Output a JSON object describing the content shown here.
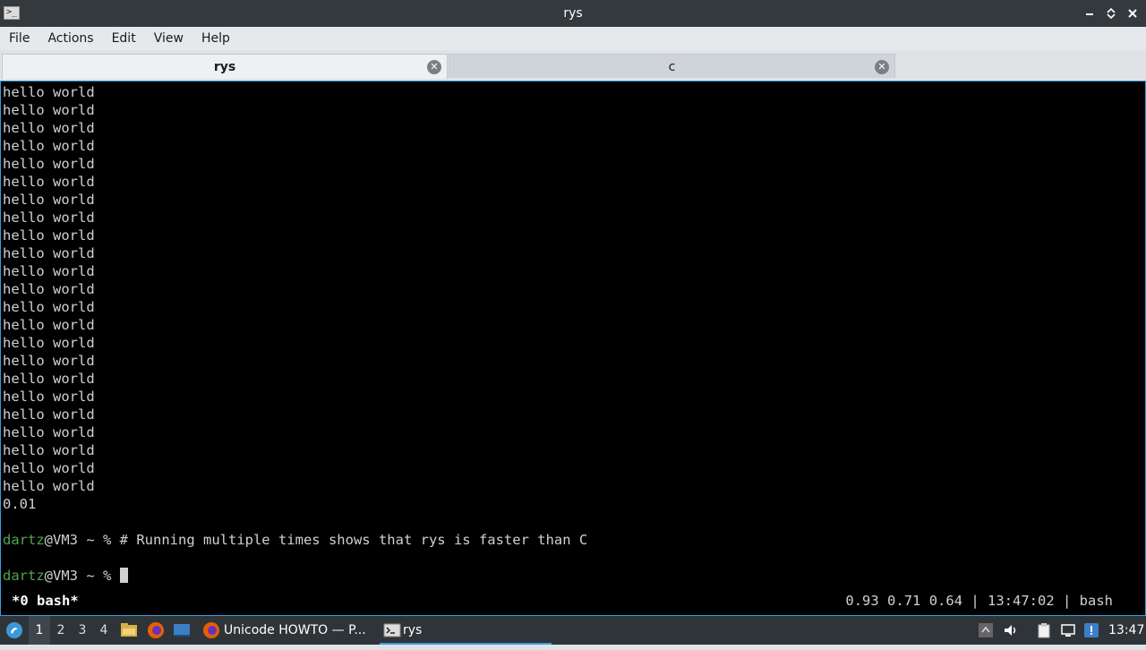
{
  "window": {
    "title": "rys",
    "app_icon_glyph": ">_"
  },
  "menu": [
    "File",
    "Actions",
    "Edit",
    "View",
    "Help"
  ],
  "tabs": [
    {
      "label": "rys",
      "active": true
    },
    {
      "label": "c",
      "active": false
    }
  ],
  "terminal": {
    "output_lines": [
      "hello world",
      "hello world",
      "hello world",
      "hello world",
      "hello world",
      "hello world",
      "hello world",
      "hello world",
      "hello world",
      "hello world",
      "hello world",
      "hello world",
      "hello world",
      "hello world",
      "hello world",
      "hello world",
      "hello world",
      "hello world",
      "hello world",
      "hello world",
      "hello world",
      "hello world",
      "hello world"
    ],
    "result_line": "0.01",
    "prompt1": {
      "user": "dartz",
      "host_path": "@VM3 ~ % ",
      "command": "# Running multiple times shows that rys is faster than C"
    },
    "prompt2": {
      "user": "dartz",
      "host_path": "@VM3 ~ % "
    },
    "status_left": "*0 bash*",
    "status_right": "0.93 0.71 0.64 | 13:47:02 | bash"
  },
  "taskbar": {
    "workspaces": [
      "1",
      "2",
      "3",
      "4"
    ],
    "active_workspace": "1",
    "tasks": [
      {
        "label": "Unicode HOWTO — P...",
        "icon": "firefox-icon"
      },
      {
        "label": "rys",
        "icon": "terminal-icon",
        "active": true
      }
    ],
    "clock": "13:47"
  },
  "colors": {
    "accent": "#3a9ad9",
    "prompt_user": "#4ea64e",
    "terminal_bg": "#000000"
  }
}
